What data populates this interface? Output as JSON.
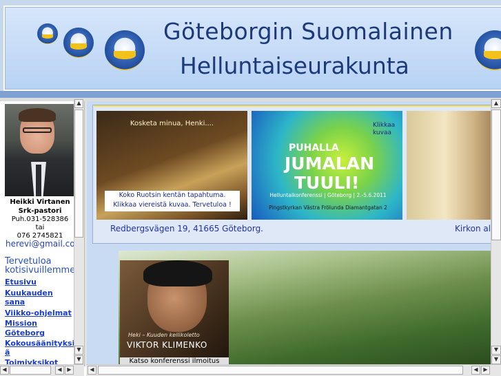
{
  "banner": {
    "title_line1": "Göteborgin Suomalainen",
    "title_line2": "Helluntaiseurakunta",
    "logo_icon": "dove-lamp-logo-icon"
  },
  "sidebar": {
    "pastor_name": "Heikki Virtanen",
    "pastor_role": "Srk-pastori",
    "phone": "Puh.031-528386",
    "or": "tai",
    "mobile": "076 2745821",
    "email": "herevi@gmail.com",
    "welcome_line1": "Tervetuloa",
    "welcome_line2": "kotisivuillemme",
    "nav": [
      "Etusivu",
      "Kuukauden",
      "sana",
      "Viikko-ohjelmat",
      "Mission",
      "Göteborg",
      "Kokousäänityksi",
      "ä",
      "Toimivksikot"
    ]
  },
  "slideshow": {
    "slide1_caption_top": "Kosketa minua, Henki....",
    "slide1_caption_l1": "Koko Ruotsin kentän tapahtuma.",
    "slide1_caption_l2": "Klikkaa viereistä kuvaa. Tervetuloa !",
    "slide2_click_l1": "Klikkaa",
    "slide2_click_l2": "kuvaa",
    "slide2_puhalla": "PUHALLA",
    "slide2_jumalan": "JUMALAN",
    "slide2_tuuli": "TUULI!",
    "slide2_conf": "Helluntaikonferenssi | Göteborg | 2.-5.6.2011",
    "slide2_church": "Pingstkyrkan Västra Frölunda Diamantgatan 2",
    "address": "Redbergsvägen 19, 41665 Göteborg.",
    "kirkon": "Kirkon al"
  },
  "album": {
    "heki_line": "Heki  – Kuuden kellikoletto",
    "artist": "VIKTOR KLIMENKO",
    "caption": "Katso  konferenssi ilmoitus"
  },
  "colors": {
    "banner_text": "#1c3a7a",
    "link": "#1a3ccc",
    "frame_bg": "#c8dbf3"
  }
}
